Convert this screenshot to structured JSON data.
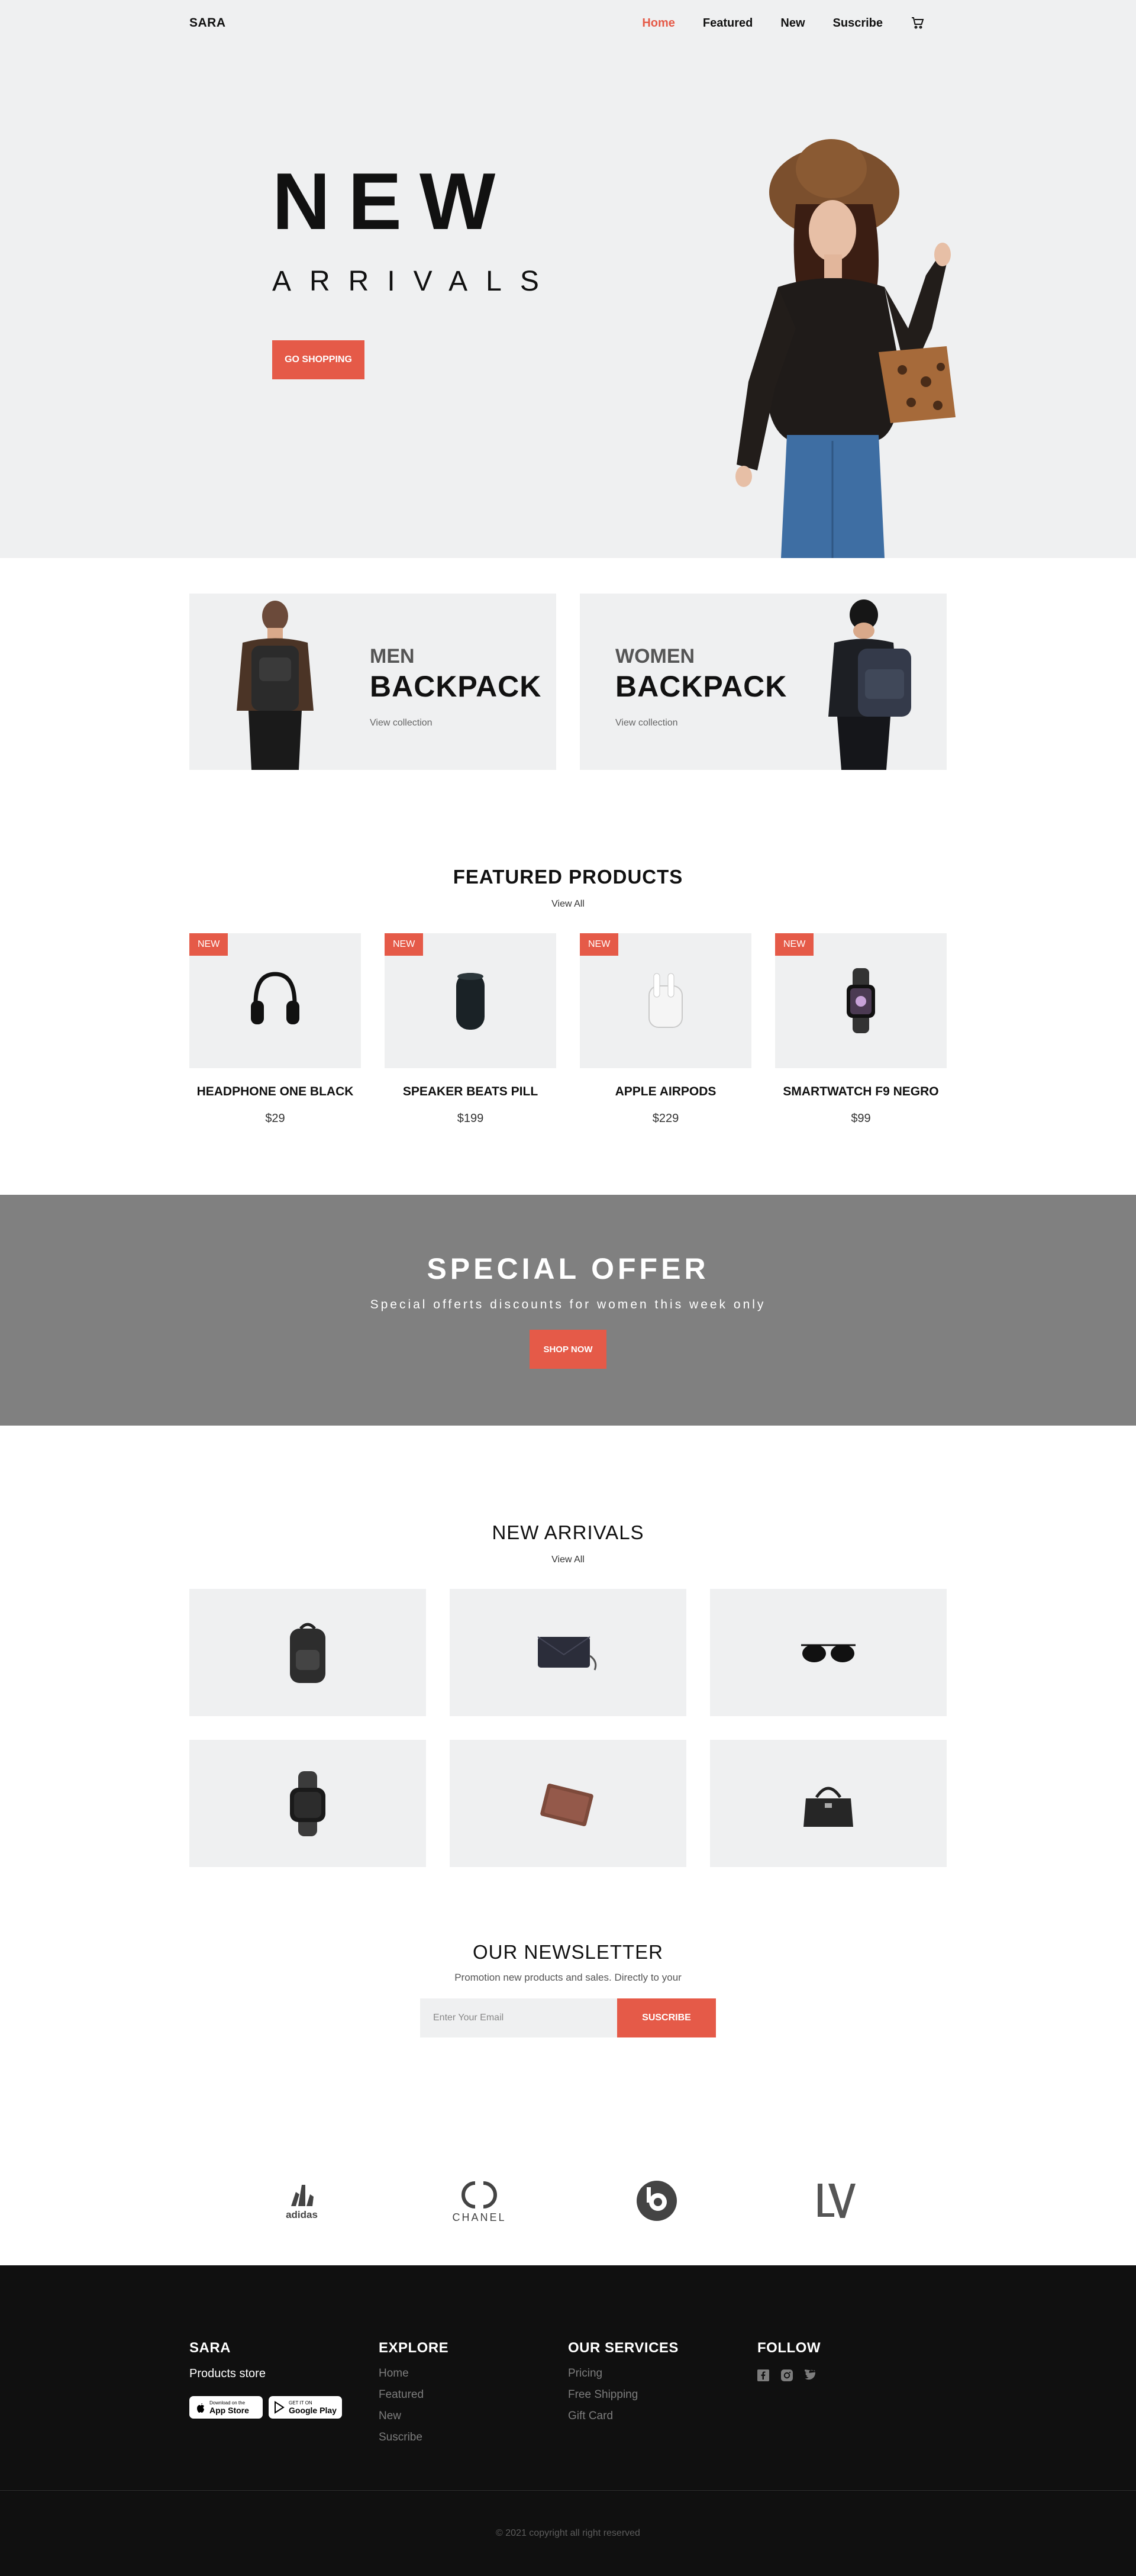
{
  "header": {
    "logo": "SARA",
    "nav": [
      "Home",
      "Featured",
      "New",
      "Suscribe"
    ],
    "active": "Home",
    "cart_icon": "shopping-cart-icon"
  },
  "hero": {
    "title": "NEW",
    "subtitle": "ARRIVALS",
    "cta": "GO SHOPPING"
  },
  "collections": [
    {
      "sub": "MEN",
      "title": "BACKPACK",
      "link": "View collection"
    },
    {
      "sub": "WOMEN",
      "title": "BACKPACK",
      "link": "View collection"
    }
  ],
  "featured": {
    "title": "FEATURED PRODUCTS",
    "view_all": "View All",
    "badge": "NEW",
    "products": [
      {
        "name": "HEADPHONE ONE BLACK",
        "price": "$29",
        "icon": "headphones-icon"
      },
      {
        "name": "SPEAKER BEATS PILL",
        "price": "$199",
        "icon": "speaker-icon"
      },
      {
        "name": "APPLE AIRPODS",
        "price": "$229",
        "icon": "airpods-icon"
      },
      {
        "name": "SMARTWATCH F9 NEGRO",
        "price": "$99",
        "icon": "smartwatch-icon"
      }
    ]
  },
  "offer": {
    "title": "SPECIAL OFFER",
    "subtitle": "Special offerts discounts for women this week only",
    "cta": "SHOP NOW"
  },
  "arrivals": {
    "title": "NEW ARRIVALS",
    "view_all": "View All",
    "items": [
      "backpack-icon",
      "clutch-bag-icon",
      "sunglasses-icon",
      "watch-icon",
      "wallet-icon",
      "handbag-icon"
    ]
  },
  "newsletter": {
    "title": "OUR NEWSLETTER",
    "subtitle": "Promotion new products and sales. Directly to your",
    "placeholder": "Enter Your Email",
    "cta": "SUSCRIBE"
  },
  "brands": [
    {
      "name": "adidas"
    },
    {
      "name": "CHANEL"
    },
    {
      "name": "beats",
      "icon": "beats-logo"
    },
    {
      "name": "LV",
      "icon": "louis-vuitton-logo"
    }
  ],
  "footer": {
    "brand": {
      "title": "SARA",
      "tagline": "Products store"
    },
    "stores": [
      {
        "small": "Download on the",
        "big": "App Store",
        "icon": "apple-icon"
      },
      {
        "small": "GET IT ON",
        "big": "Google Play",
        "icon": "google-play-icon"
      }
    ],
    "explore": {
      "title": "EXPLORE",
      "links": [
        "Home",
        "Featured",
        "New",
        "Suscribe"
      ]
    },
    "services": {
      "title": "OUR SERVICES",
      "links": [
        "Pricing",
        "Free Shipping",
        "Gift Card"
      ]
    },
    "follow": {
      "title": "FOLLOW",
      "icons": [
        "facebook-icon",
        "instagram-icon",
        "twitter-icon"
      ]
    },
    "copyright": "© 2021 copyright all right reserved"
  },
  "colors": {
    "accent": "#e55a48",
    "light_bg": "#eff0f1",
    "offer_bg": "#808080",
    "footer_bg": "#101010"
  }
}
